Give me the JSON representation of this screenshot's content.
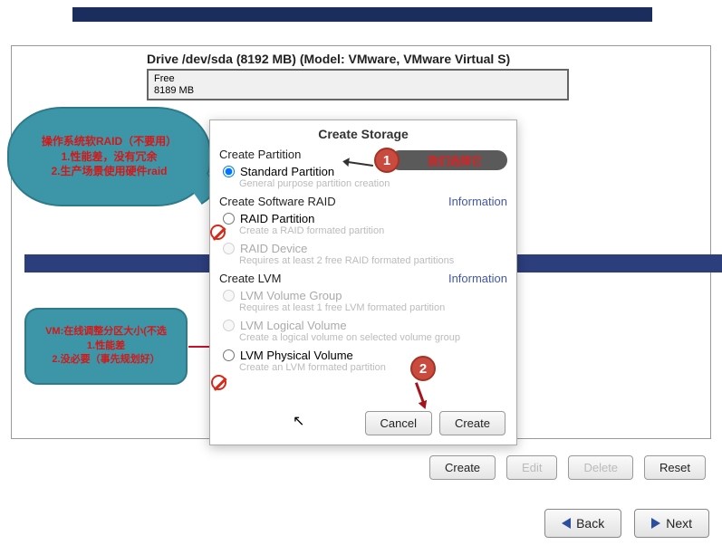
{
  "drive": {
    "title": "Drive /dev/sda (8192 MB) (Model: VMware, VMware Virtual S)",
    "free_label": "Free",
    "free_size": "8189 MB"
  },
  "dialog": {
    "title": "Create Storage",
    "section_partition": "Create Partition",
    "standard_partition": "Standard Partition",
    "standard_partition_desc": "General purpose partition creation",
    "section_raid": "Create Software RAID",
    "info_link": "Information",
    "raid_partition": "RAID Partition",
    "raid_partition_desc": "Create a RAID formated partition",
    "raid_device": "RAID Device",
    "raid_device_desc": "Requires at least 2 free RAID formated partitions",
    "section_lvm": "Create LVM",
    "lvm_vg": "LVM Volume Group",
    "lvm_vg_desc": "Requires at least 1 free LVM formated partition",
    "lvm_lv": "LVM Logical Volume",
    "lvm_lv_desc": "Create a logical volume on selected volume group",
    "lvm_pv": "LVM Physical Volume",
    "lvm_pv_desc": "Create an LVM formated partition",
    "cancel": "Cancel",
    "create": "Create"
  },
  "annotations": {
    "bubble1_line1": "操作系统软RAID（不要用）",
    "bubble1_line2": "1.性能差，没有冗余",
    "bubble1_line3": "2.生产场景使用硬件raid",
    "bubble2_line1": "VM:在线调整分区大小(不选",
    "bubble2_line2": "1.性能差",
    "bubble2_line3": "2.没必要（事先规划好）",
    "num1": "1",
    "num2": "2",
    "tag1": "我们选择它"
  },
  "bottom": {
    "create": "Create",
    "edit": "Edit",
    "delete": "Delete",
    "reset": "Reset"
  },
  "nav": {
    "back": "Back",
    "next": "Next"
  }
}
